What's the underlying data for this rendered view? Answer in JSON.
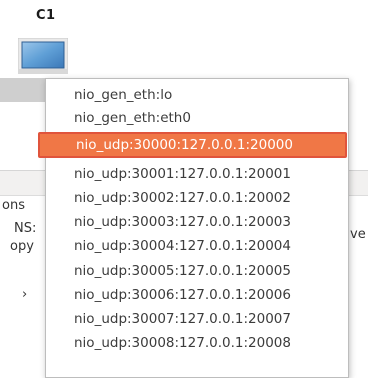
{
  "node": {
    "label": "C1",
    "icon": "cloud-node-icon"
  },
  "background": {
    "left_fragments": [
      "ons",
      "NS:",
      "opy",
      "›"
    ],
    "right_fragment": "ve"
  },
  "menu": {
    "items": [
      {
        "label": "nio_gen_eth:lo",
        "selected": false
      },
      {
        "label": "nio_gen_eth:eth0",
        "selected": false
      },
      {
        "label": "nio_udp:30000:127.0.0.1:20000",
        "selected": true
      },
      {
        "label": "nio_udp:30001:127.0.0.1:20001",
        "selected": false
      },
      {
        "label": "nio_udp:30002:127.0.0.1:20002",
        "selected": false
      },
      {
        "label": "nio_udp:30003:127.0.0.1:20003",
        "selected": false
      },
      {
        "label": "nio_udp:30004:127.0.0.1:20004",
        "selected": false
      },
      {
        "label": "nio_udp:30005:127.0.0.1:20005",
        "selected": false
      },
      {
        "label": "nio_udp:30006:127.0.0.1:20006",
        "selected": false
      },
      {
        "label": "nio_udp:30007:127.0.0.1:20007",
        "selected": false
      },
      {
        "label": "nio_udp:30008:127.0.0.1:20008",
        "selected": false
      }
    ]
  },
  "colors": {
    "selection_fill": "#f07746",
    "selection_border": "#e0543c"
  }
}
